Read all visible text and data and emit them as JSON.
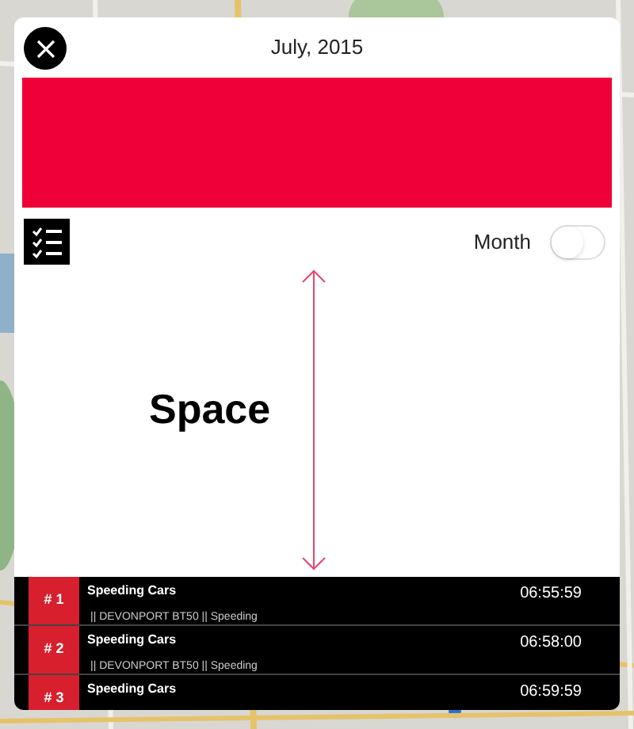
{
  "header": {
    "title": "July, 2015"
  },
  "toolbar": {
    "toggle": {
      "label": "Month",
      "on": false
    }
  },
  "annotation": {
    "label": "Space"
  },
  "events": [
    {
      "rank": "# 1",
      "title": "Speeding Cars",
      "time": "06:55:59",
      "detail": "|| DEVONPORT BT50 || Speeding"
    },
    {
      "rank": "# 2",
      "title": "Speeding Cars",
      "time": "06:58:00",
      "detail": "|| DEVONPORT BT50 || Speeding"
    },
    {
      "rank": "# 3",
      "title": "Speeding Cars",
      "time": "06:59:59"
    }
  ]
}
